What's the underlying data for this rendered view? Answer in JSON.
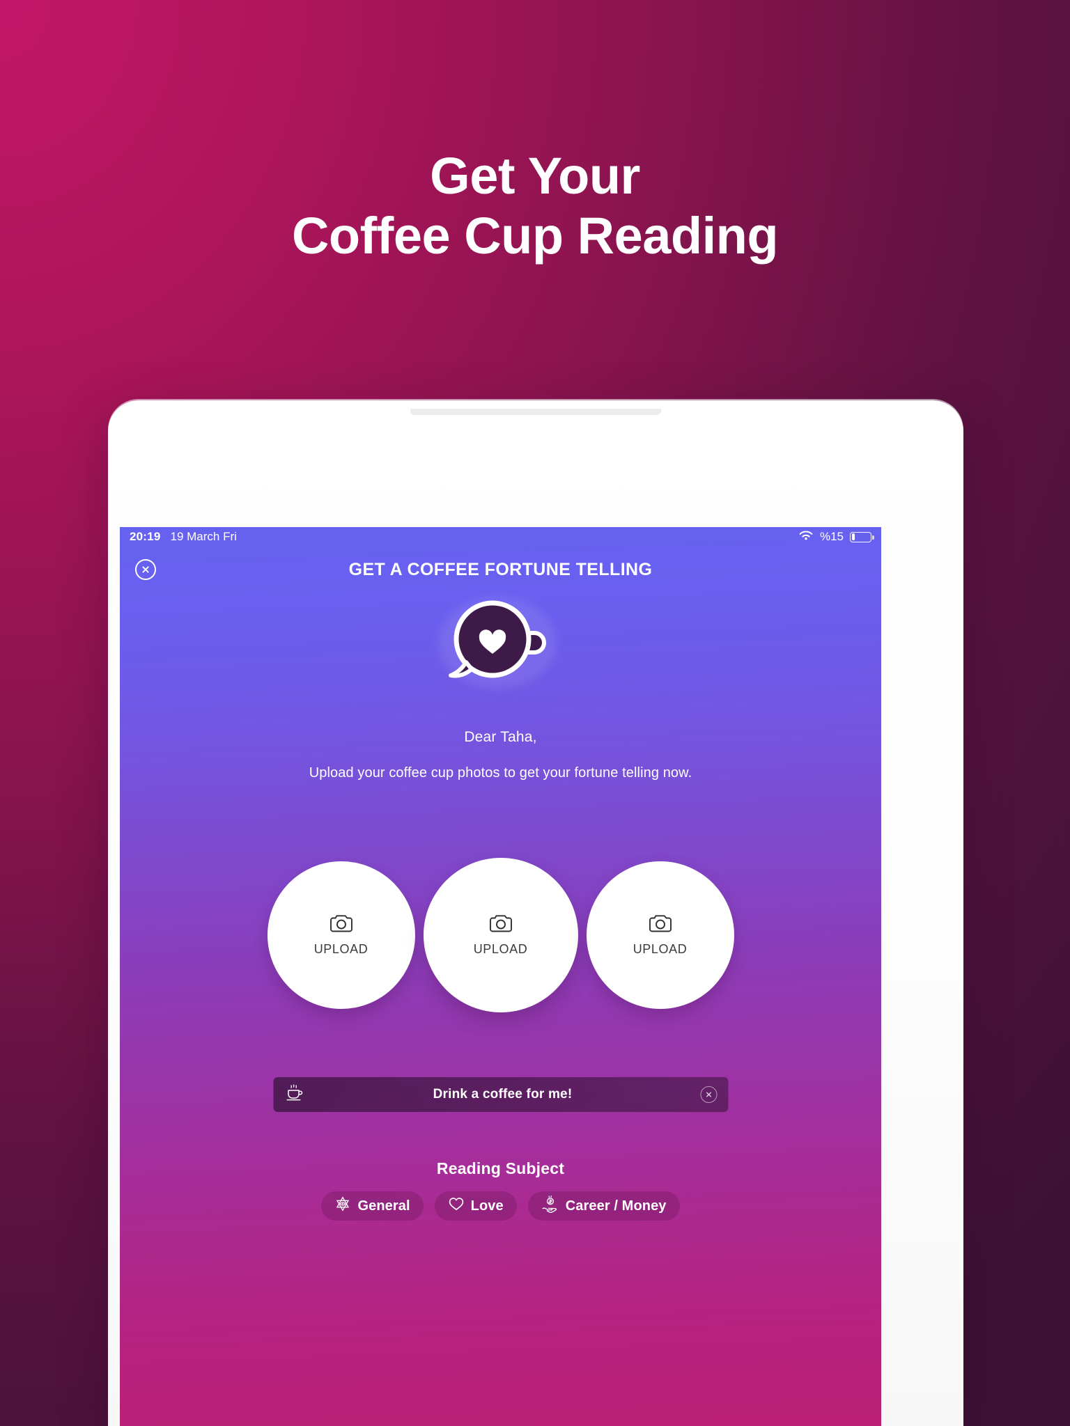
{
  "promo": {
    "headline_line1": "Get Your",
    "headline_line2": "Coffee Cup Reading",
    "background_from": "#c2166a",
    "background_to": "#3c1137"
  },
  "device": {
    "frame_color": "#ffffff"
  },
  "app": {
    "status_bar": {
      "time": "20:19",
      "date": "19 March Fri",
      "battery_percent": "%15",
      "battery_level": 15,
      "wifi_icon": "wifi-icon",
      "battery_icon": "battery-icon"
    },
    "header": {
      "title": "GET A COFFEE FORTUNE TELLING",
      "close_icon": "close-icon"
    },
    "logo": {
      "icon": "coffee-cup-heart-logo",
      "cup_color": "#3e1a49",
      "heart_color": "#ffffff",
      "outline_color": "#ffffff"
    },
    "greeting": "Dear Taha,",
    "subtext": "Upload your coffee cup photos to get your fortune telling now.",
    "uploads": [
      {
        "label": "UPLOAD",
        "icon": "camera-icon"
      },
      {
        "label": "UPLOAD",
        "icon": "camera-icon"
      },
      {
        "label": "UPLOAD",
        "icon": "camera-icon"
      }
    ],
    "promo_banner": {
      "text": "Drink a coffee for me!",
      "left_icon": "coffee-cup-steam-icon",
      "close_icon": "close-icon"
    },
    "reading_subject": {
      "title": "Reading Subject",
      "chips": [
        {
          "label": "General",
          "icon": "star-eye-icon"
        },
        {
          "label": "Love",
          "icon": "heart-icon"
        },
        {
          "label": "Career / Money",
          "icon": "hand-coin-icon"
        }
      ]
    },
    "screen_gradient_top": "#6562ef",
    "screen_gradient_mid": "#8d3bb6",
    "screen_gradient_bottom": "#bb1f74"
  }
}
